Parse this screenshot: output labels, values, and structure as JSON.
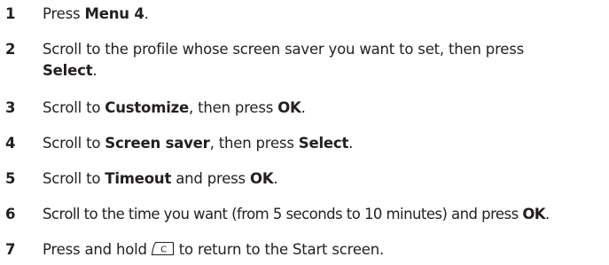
{
  "steps": [
    {
      "number": "1",
      "parts": [
        {
          "text": "Press ",
          "bold": false
        },
        {
          "text": "Menu 4",
          "bold": true
        },
        {
          "text": ".",
          "bold": false
        }
      ]
    },
    {
      "number": "2",
      "line1": [
        {
          "text": "Scroll to the profile whose screen saver you want to set, then press",
          "bold": false
        }
      ],
      "line2": [
        {
          "text": "Select",
          "bold": true
        },
        {
          "text": ".",
          "bold": false
        }
      ]
    },
    {
      "number": "3",
      "parts": [
        {
          "text": "Scroll to ",
          "bold": false
        },
        {
          "text": "Customize",
          "bold": true
        },
        {
          "text": ", then press ",
          "bold": false
        },
        {
          "text": "OK",
          "bold": true
        },
        {
          "text": ".",
          "bold": false
        }
      ]
    },
    {
      "number": "4",
      "parts": [
        {
          "text": "Scroll to ",
          "bold": false
        },
        {
          "text": "Screen saver",
          "bold": true
        },
        {
          "text": ", then press ",
          "bold": false
        },
        {
          "text": "Select",
          "bold": true
        },
        {
          "text": ".",
          "bold": false
        }
      ]
    },
    {
      "number": "5",
      "parts": [
        {
          "text": "Scroll to ",
          "bold": false
        },
        {
          "text": "Timeout",
          "bold": true
        },
        {
          "text": " and press ",
          "bold": false
        },
        {
          "text": "OK",
          "bold": true
        },
        {
          "text": ".",
          "bold": false
        }
      ]
    },
    {
      "number": "6",
      "parts": [
        {
          "text": "Scroll to the time you want (from 5 seconds to 10 minutes) and press ",
          "bold": false
        },
        {
          "text": "OK",
          "bold": true
        },
        {
          "text": ".",
          "bold": false
        }
      ]
    },
    {
      "number": "7",
      "before_icon": "Press and hold",
      "icon": "clear-key-icon",
      "icon_label": "C",
      "after_icon": "to return to the Start screen."
    }
  ]
}
